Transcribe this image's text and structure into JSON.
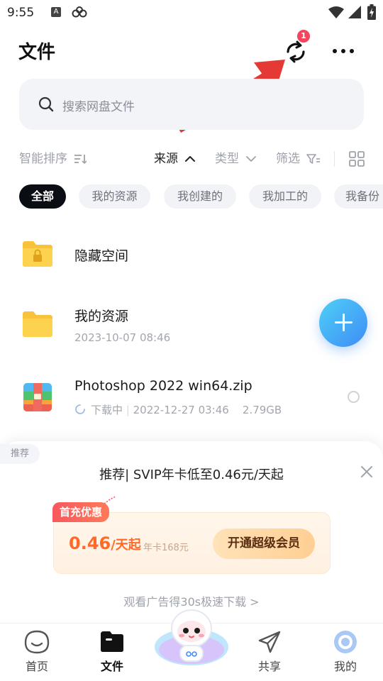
{
  "status_bar": {
    "time": "9:55",
    "notif_icon_a_letter": "A",
    "icons": [
      "notification-a-icon",
      "cloud-app-icon",
      "wifi-icon",
      "signal-icon",
      "battery-charging-icon"
    ]
  },
  "header": {
    "title": "文件",
    "sync_badge": "1",
    "sync_icon": "sync-icon",
    "more_icon": "more-horizontal-icon"
  },
  "search": {
    "placeholder": "搜索网盘文件"
  },
  "sort_bar": {
    "smart_sort": "智能排序",
    "source": "来源",
    "type": "类型",
    "filter": "筛选"
  },
  "chips": [
    {
      "label": "全部",
      "active": true
    },
    {
      "label": "我的资源",
      "active": false
    },
    {
      "label": "我创建的",
      "active": false
    },
    {
      "label": "我加工的",
      "active": false
    },
    {
      "label": "我备份",
      "active": false
    }
  ],
  "files": [
    {
      "name": "隐藏空间",
      "type": "locked-folder"
    },
    {
      "name": "我的资源",
      "date": "2023-10-07  08:46",
      "type": "folder"
    },
    {
      "name": "Photoshop 2022 win64.zip",
      "status": "下载中",
      "date": "2022-12-27  03:46",
      "size": "2.79GB",
      "type": "zip"
    }
  ],
  "promo": {
    "tag": "推荐",
    "title": "推荐| SVIP年卡低至0.46元/天起",
    "badge": "首充优惠",
    "price": "0.46",
    "price_unit": "/天起",
    "year_price": "年卡168元",
    "cta": "开通超级会员",
    "ad_link": "观看广告得30s极速下载 >"
  },
  "bottom_nav": [
    {
      "label": "首页",
      "icon": "home-icon",
      "active": false
    },
    {
      "label": "文件",
      "icon": "folder-icon",
      "active": true
    },
    {
      "label": "共享",
      "icon": "share-plane-icon",
      "active": false
    },
    {
      "label": "我的",
      "icon": "profile-icon",
      "active": false
    }
  ],
  "colors": {
    "accent_blue": "#3e8cf7",
    "badge_red": "#f5455c",
    "price_orange": "#ff6a2a",
    "chip_active": "#0b0d14",
    "arrow_red": "#e53935"
  }
}
